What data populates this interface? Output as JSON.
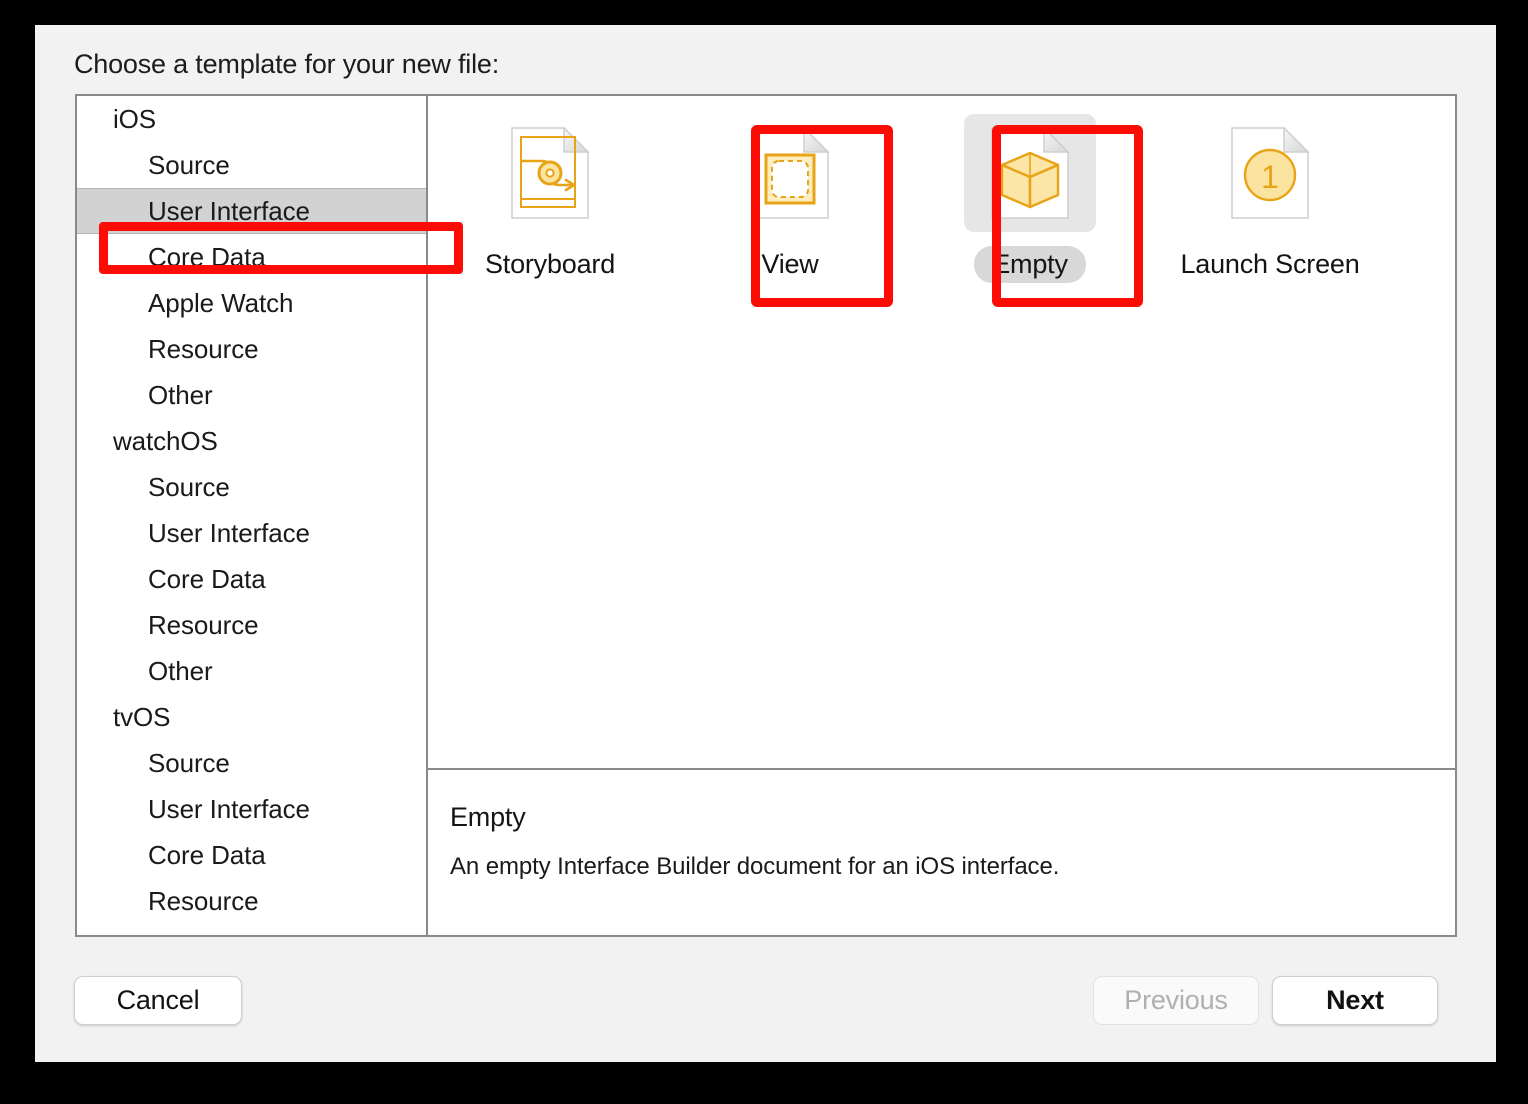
{
  "dialog": {
    "prompt": "Choose a template for your new file:"
  },
  "sidebar": {
    "rows": [
      {
        "label": "iOS",
        "type": "group",
        "selected": false
      },
      {
        "label": "Source",
        "type": "child",
        "selected": false
      },
      {
        "label": "User Interface",
        "type": "child",
        "selected": true
      },
      {
        "label": "Core Data",
        "type": "child",
        "selected": false
      },
      {
        "label": "Apple Watch",
        "type": "child",
        "selected": false
      },
      {
        "label": "Resource",
        "type": "child",
        "selected": false
      },
      {
        "label": "Other",
        "type": "child",
        "selected": false
      },
      {
        "label": "watchOS",
        "type": "group",
        "selected": false
      },
      {
        "label": "Source",
        "type": "child",
        "selected": false
      },
      {
        "label": "User Interface",
        "type": "child",
        "selected": false
      },
      {
        "label": "Core Data",
        "type": "child",
        "selected": false
      },
      {
        "label": "Resource",
        "type": "child",
        "selected": false
      },
      {
        "label": "Other",
        "type": "child",
        "selected": false
      },
      {
        "label": "tvOS",
        "type": "group",
        "selected": false
      },
      {
        "label": "Source",
        "type": "child",
        "selected": false
      },
      {
        "label": "User Interface",
        "type": "child",
        "selected": false
      },
      {
        "label": "Core Data",
        "type": "child",
        "selected": false
      },
      {
        "label": "Resource",
        "type": "child",
        "selected": false
      }
    ]
  },
  "templates": [
    {
      "label": "Storyboard",
      "icon": "storyboard-document-icon",
      "selected": false
    },
    {
      "label": "View",
      "icon": "view-document-icon",
      "selected": false
    },
    {
      "label": "Empty",
      "icon": "empty-cube-document-icon",
      "selected": true
    },
    {
      "label": "Launch Screen",
      "icon": "launch-screen-document-icon",
      "selected": false
    }
  ],
  "description": {
    "title": "Empty",
    "body": "An empty Interface Builder document for an iOS interface."
  },
  "footer": {
    "cancel": "Cancel",
    "previous": "Previous",
    "next": "Next"
  },
  "annotations": {
    "highlight_color": "#fb0d06",
    "boxes": [
      "sidebar-user-interface",
      "template-view",
      "template-empty"
    ]
  },
  "colors": {
    "window_bg": "#f2f2f2",
    "panel_bg": "#ffffff",
    "selection_gray": "#d2d2d2",
    "icon_accent": "#e8a317",
    "icon_fill": "#fbe3a0"
  }
}
